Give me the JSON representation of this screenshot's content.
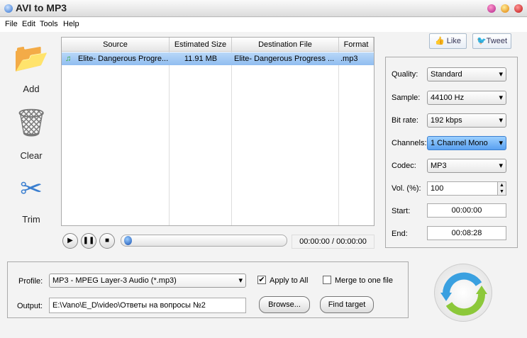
{
  "window": {
    "title": "AVI to MP3"
  },
  "menu": [
    "File",
    "Edit",
    "Tools",
    "Help"
  ],
  "sidebar": {
    "add": "Add",
    "clear": "Clear",
    "trim": "Trim"
  },
  "social": {
    "like": "Like",
    "tweet": "Tweet"
  },
  "table": {
    "headers": [
      "Source",
      "Estimated Size",
      "Destination File",
      "Format"
    ],
    "rows": [
      {
        "source": "Elite- Dangerous Progre...",
        "size": "11.91 MB",
        "dest": "Elite- Dangerous Progress ...",
        "format": ".mp3"
      }
    ]
  },
  "player": {
    "time": "00:00:00 / 00:00:00",
    "progress": 0
  },
  "settings": {
    "quality_label": "Quality:",
    "quality": "Standard",
    "sample_label": "Sample:",
    "sample": "44100 Hz",
    "bitrate_label": "Bit rate:",
    "bitrate": "192 kbps",
    "channels_label": "Channels:",
    "channels": "1 Channel Mono",
    "codec_label": "Codec:",
    "codec": "MP3",
    "vol_label": "Vol. (%):",
    "vol": "100",
    "start_label": "Start:",
    "start": "00:00:00",
    "end_label": "End:",
    "end": "00:08:28"
  },
  "output": {
    "profile_label": "Profile:",
    "profile": "MP3 - MPEG Layer-3 Audio (*.mp3)",
    "apply_all": "Apply to All",
    "apply_all_checked": true,
    "merge": "Merge to one file",
    "merge_checked": false,
    "output_label": "Output:",
    "output_path": "E:\\Vano\\E_D\\video\\Ответы на вопросы №2",
    "browse": "Browse...",
    "find_target": "Find target"
  }
}
